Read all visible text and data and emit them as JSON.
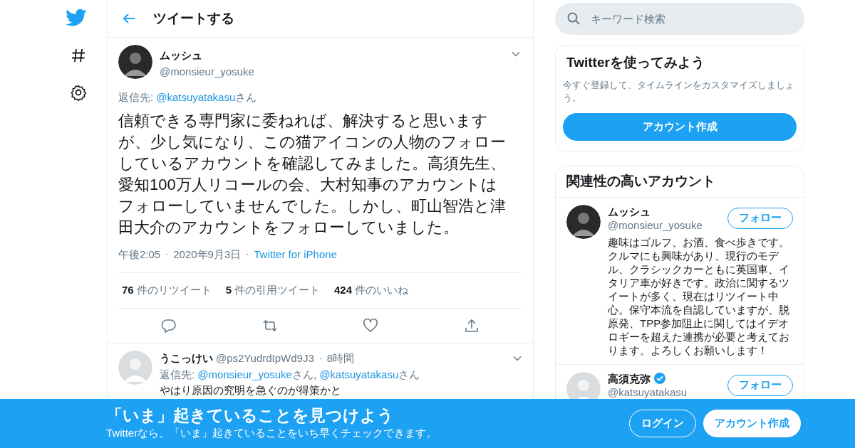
{
  "header": {
    "title": "ツイートする"
  },
  "tweet": {
    "name": "ムッシュ",
    "handle": "@monsieur_yosuke",
    "reply_prefix": "返信先:",
    "reply_to": [
      {
        "handle": "@katsuyatakasu",
        "suffix": "さん"
      }
    ],
    "body": "信頼できる専門家に委ねれば、解決すると思いますが、少し気になり、この猫アイコンの人物のフォローしているアカウントを確認してみました。高須先生、愛知100万人リコールの会、大村知事のアカウントはフォローしていませんでした。しかし、町山智浩と津田大介のアカウントをフォローしていました。",
    "time": "午後2:05",
    "separator": "・",
    "date": "2020年9月3日",
    "source": "Twitter for iPhone",
    "stats": [
      {
        "count": "76",
        "label": "件のリツイート"
      },
      {
        "count": "5",
        "label": "件の引用ツイート"
      },
      {
        "count": "424",
        "label": "件のいいね"
      }
    ]
  },
  "replies": [
    {
      "name": "うこっけい",
      "handle": "@ps2YudrdIpWd9J3",
      "separator": "・",
      "age": "8時間",
      "reply_prefix": "返信先:",
      "reply_to": [
        {
          "handle": "@monsieur_yosuke",
          "suffix": "さん,"
        },
        {
          "handle": "@katsuyatakasu",
          "suffix": "さん"
        }
      ],
      "body": "やはり原因の究明を急ぐのが得策かと"
    }
  ],
  "search": {
    "placeholder": "キーワード検索"
  },
  "signup_card": {
    "title": "Twitterを使ってみよう",
    "text": "今すぐ登録して、タイムラインをカスタマイズしましょう。",
    "button": "アカウント作成"
  },
  "related": {
    "title": "関連性の高いアカウント",
    "accounts": [
      {
        "name": "ムッシュ",
        "handle": "@monsieur_yosuke",
        "verified": false,
        "follow": "フォロー",
        "bio": "趣味はゴルフ、お酒、食べ歩きです。クルマにも興味があり、現行のモデル、クラシックカーともに英国車、イタリア車が好きです。政治に関するツイートが多く、現在はリツイート中心。保守本流を自認していますが、脱原発、TPP参加阻止に関してはイデオロギーを超えた連携が必要と考えております。よろしくお願いします！"
      },
      {
        "name": "高須克弥",
        "handle": "@katsuyatakasu",
        "verified": true,
        "follow": "フォロー"
      }
    ]
  },
  "banner": {
    "title": "「いま」起きていることを見つけよう",
    "subtitle": "Twitterなら、「いま」起きていることをいち早くチェックできます。",
    "login": "ログイン",
    "signup": "アカウント作成"
  }
}
